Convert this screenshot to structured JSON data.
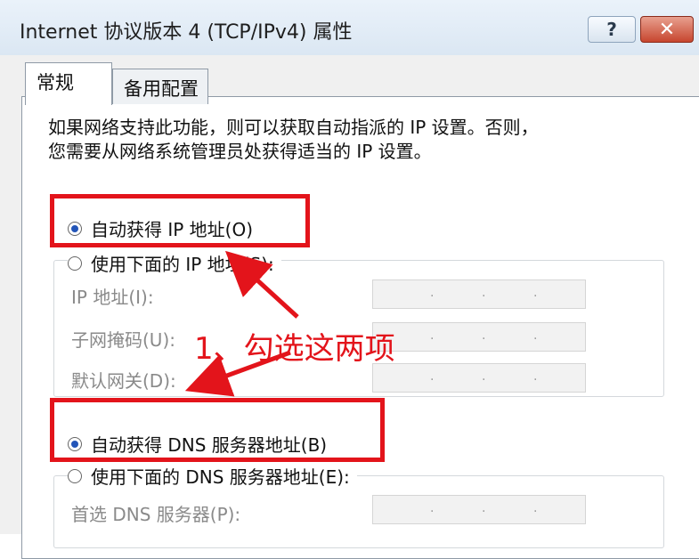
{
  "window": {
    "title": "Internet 协议版本 4 (TCP/IPv4) 属性",
    "help_glyph": "?",
    "close_glyph": "✕"
  },
  "tabs": [
    {
      "label": "常规",
      "active": true
    },
    {
      "label": "备用配置",
      "active": false
    }
  ],
  "description": {
    "line1": "如果网络支持此功能，则可以获取自动指派的 IP 设置。否则，",
    "line2": "您需要从网络系统管理员处获得适当的 IP 设置。"
  },
  "ip_section": {
    "auto_label": "自动获得 IP 地址(O)",
    "manual_label": "使用下面的 IP 地址(S):",
    "auto_selected": true,
    "fields": [
      {
        "label": "IP 地址(I):",
        "value": ""
      },
      {
        "label": "子网掩码(U):",
        "value": ""
      },
      {
        "label": "默认网关(D):",
        "value": ""
      }
    ]
  },
  "dns_section": {
    "auto_label": "自动获得 DNS 服务器地址(B)",
    "manual_label": "使用下面的 DNS 服务器地址(E):",
    "auto_selected": true,
    "fields": [
      {
        "label": "首选 DNS 服务器(P):",
        "value": ""
      }
    ]
  },
  "annotation": {
    "text": "1、勾选这两项",
    "color": "#e3141b"
  },
  "ip_separator": "."
}
